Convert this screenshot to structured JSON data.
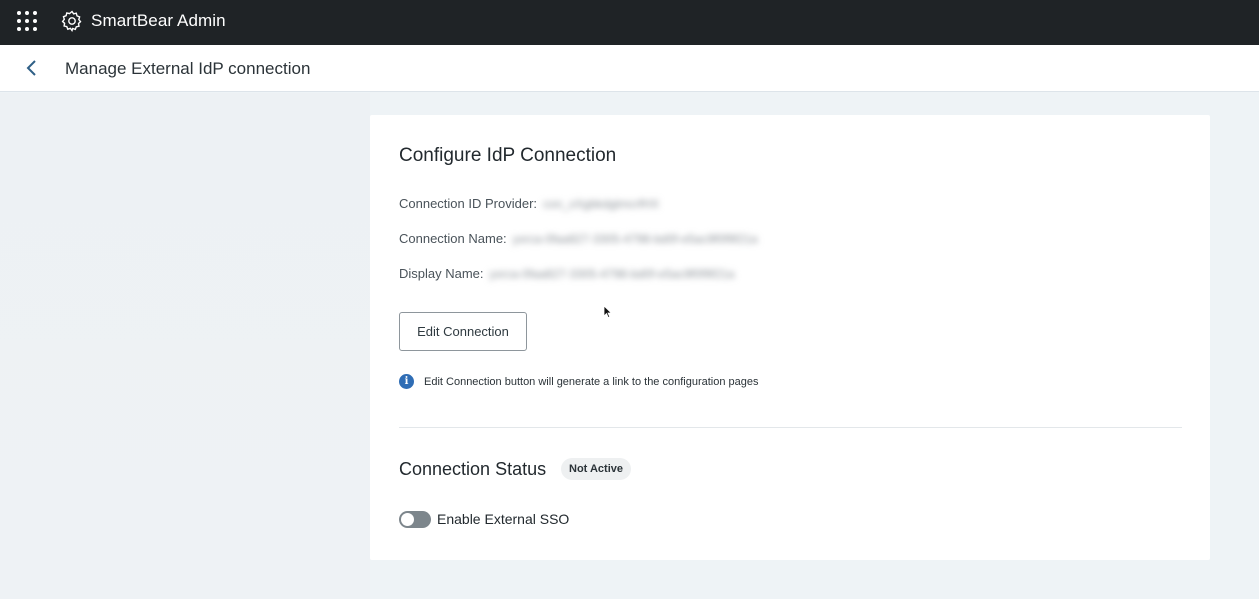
{
  "topbar": {
    "app_title": "SmartBear Admin",
    "apps_icon": "apps-grid-icon",
    "gear_icon": "gear-icon"
  },
  "subheader": {
    "back_icon": "chevron-left-icon",
    "title": "Manage External IdP connection"
  },
  "card": {
    "heading": "Configure IdP Connection",
    "fields": [
      {
        "label": "Connection ID Provider:",
        "value": "con_xXgbkdgtmcrfHX"
      },
      {
        "label": "Connection Name:",
        "value": "yxrca-0faa827-3305-4798-bd0f-e5ac9f0f9f21a"
      },
      {
        "label": "Display Name:",
        "value": "yxrca-0faa827-3305-4798-bd0f-e5ac9f0f9f21a"
      }
    ],
    "edit_button": "Edit Connection",
    "info_text": "Edit Connection button will generate a link to the configuration pages",
    "status_title": "Connection Status",
    "status_badge": "Not Active",
    "toggle_label": "Enable External SSO",
    "toggle_enabled": false
  },
  "colors": {
    "topbar_bg": "#1f2326",
    "info_blue": "#2f6db5",
    "toggle_off": "#7d868c"
  }
}
